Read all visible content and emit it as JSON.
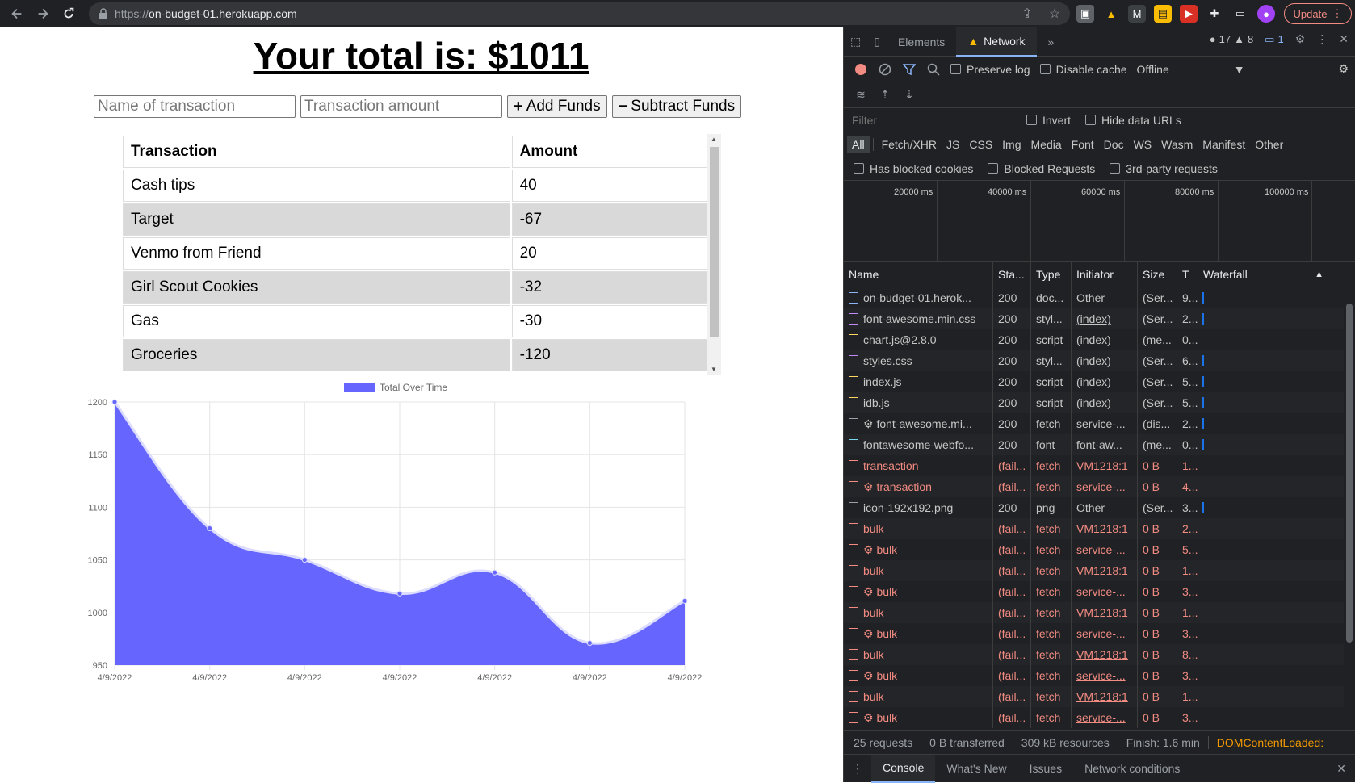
{
  "browser": {
    "url_scheme": "https://",
    "url_host": "on-budget-01.herokuapp.com",
    "update_label": "Update"
  },
  "page": {
    "total_text": "Your total is: $1011",
    "name_placeholder": "Name of transaction",
    "amount_placeholder": "Transaction amount",
    "add_label": "Add Funds",
    "subtract_label": "Subtract Funds",
    "table": {
      "headers": [
        "Transaction",
        "Amount"
      ],
      "rows": [
        [
          "Cash tips",
          "40"
        ],
        [
          "Target",
          "-67"
        ],
        [
          "Venmo from Friend",
          "20"
        ],
        [
          "Girl Scout Cookies",
          "-32"
        ],
        [
          "Gas",
          "-30"
        ],
        [
          "Groceries",
          "-120"
        ]
      ]
    }
  },
  "chart_data": {
    "type": "area",
    "legend": "Total Over Time",
    "legend_position": "top",
    "color": "#6666ff",
    "x": [
      "4/9/2022",
      "4/9/2022",
      "4/9/2022",
      "4/9/2022",
      "4/9/2022",
      "4/9/2022",
      "4/9/2022"
    ],
    "values": [
      1200,
      1080,
      1050,
      1018,
      1038,
      971,
      1011
    ],
    "ylim": [
      950,
      1200
    ],
    "yticks": [
      950,
      1000,
      1050,
      1100,
      1150,
      1200
    ],
    "grid": true
  },
  "devtools": {
    "tabs": [
      "Elements",
      "Network"
    ],
    "active_tab": "Network",
    "badges": {
      "errors": "17",
      "warnings": "8",
      "messages": "1"
    },
    "toolbar": {
      "preserve_log": "Preserve log",
      "disable_cache": "Disable cache",
      "throttle": "Offline"
    },
    "filter_placeholder": "Filter",
    "invert": "Invert",
    "hide_data_urls": "Hide data URLs",
    "types": [
      "All",
      "Fetch/XHR",
      "JS",
      "CSS",
      "Img",
      "Media",
      "Font",
      "Doc",
      "WS",
      "Wasm",
      "Manifest",
      "Other"
    ],
    "blocked": [
      "Has blocked cookies",
      "Blocked Requests",
      "3rd-party requests"
    ],
    "overview_labels": [
      "20000 ms",
      "40000 ms",
      "60000 ms",
      "80000 ms",
      "100000 ms"
    ],
    "columns": [
      "Name",
      "Sta...",
      "Type",
      "Initiator",
      "Size",
      "T",
      "Waterfall"
    ],
    "requests": [
      {
        "name": "on-budget-01.herok...",
        "status": "200",
        "type": "doc...",
        "initiator": "Other",
        "size": "(Ser...",
        "time": "9...",
        "fail": false,
        "link": false,
        "icon": "doc",
        "bar": true
      },
      {
        "name": "font-awesome.min.css",
        "status": "200",
        "type": "styl...",
        "initiator": "(index)",
        "size": "(Ser...",
        "time": "2...",
        "fail": false,
        "link": true,
        "icon": "css",
        "bar": true
      },
      {
        "name": "chart.js@2.8.0",
        "status": "200",
        "type": "script",
        "initiator": "(index)",
        "size": "(me...",
        "time": "0...",
        "fail": false,
        "link": true,
        "icon": "js",
        "bar": false
      },
      {
        "name": "styles.css",
        "status": "200",
        "type": "styl...",
        "initiator": "(index)",
        "size": "(Ser...",
        "time": "6...",
        "fail": false,
        "link": true,
        "icon": "css",
        "bar": true
      },
      {
        "name": "index.js",
        "status": "200",
        "type": "script",
        "initiator": "(index)",
        "size": "(Ser...",
        "time": "5...",
        "fail": false,
        "link": true,
        "icon": "js",
        "bar": true
      },
      {
        "name": "idb.js",
        "status": "200",
        "type": "script",
        "initiator": "(index)",
        "size": "(Ser...",
        "time": "5...",
        "fail": false,
        "link": true,
        "icon": "js",
        "bar": true
      },
      {
        "name": "⚙ font-awesome.mi...",
        "status": "200",
        "type": "fetch",
        "initiator": "service-...",
        "size": "(dis...",
        "time": "2...",
        "fail": false,
        "link": true,
        "icon": "blank",
        "bar": true
      },
      {
        "name": "fontawesome-webfo...",
        "status": "200",
        "type": "font",
        "initiator": "font-aw...",
        "size": "(me...",
        "time": "0...",
        "fail": false,
        "link": true,
        "icon": "font",
        "bar": true
      },
      {
        "name": "transaction",
        "status": "(fail...",
        "type": "fetch",
        "initiator": "VM1218:1",
        "size": "0 B",
        "time": "1...",
        "fail": true,
        "link": true,
        "icon": "fail",
        "bar": false
      },
      {
        "name": "⚙ transaction",
        "status": "(fail...",
        "type": "fetch",
        "initiator": "service-...",
        "size": "0 B",
        "time": "4...",
        "fail": true,
        "link": true,
        "icon": "fail",
        "bar": false
      },
      {
        "name": "icon-192x192.png",
        "status": "200",
        "type": "png",
        "initiator": "Other",
        "size": "(Ser...",
        "time": "3...",
        "fail": false,
        "link": false,
        "icon": "blank",
        "bar": true
      },
      {
        "name": "bulk",
        "status": "(fail...",
        "type": "fetch",
        "initiator": "VM1218:1",
        "size": "0 B",
        "time": "2...",
        "fail": true,
        "link": true,
        "icon": "fail",
        "bar": false
      },
      {
        "name": "⚙ bulk",
        "status": "(fail...",
        "type": "fetch",
        "initiator": "service-...",
        "size": "0 B",
        "time": "5...",
        "fail": true,
        "link": true,
        "icon": "fail",
        "bar": false
      },
      {
        "name": "bulk",
        "status": "(fail...",
        "type": "fetch",
        "initiator": "VM1218:1",
        "size": "0 B",
        "time": "1...",
        "fail": true,
        "link": true,
        "icon": "fail",
        "bar": false
      },
      {
        "name": "⚙ bulk",
        "status": "(fail...",
        "type": "fetch",
        "initiator": "service-...",
        "size": "0 B",
        "time": "3...",
        "fail": true,
        "link": true,
        "icon": "fail",
        "bar": false
      },
      {
        "name": "bulk",
        "status": "(fail...",
        "type": "fetch",
        "initiator": "VM1218:1",
        "size": "0 B",
        "time": "1...",
        "fail": true,
        "link": true,
        "icon": "fail",
        "bar": false
      },
      {
        "name": "⚙ bulk",
        "status": "(fail...",
        "type": "fetch",
        "initiator": "service-...",
        "size": "0 B",
        "time": "3...",
        "fail": true,
        "link": true,
        "icon": "fail",
        "bar": false
      },
      {
        "name": "bulk",
        "status": "(fail...",
        "type": "fetch",
        "initiator": "VM1218:1",
        "size": "0 B",
        "time": "8...",
        "fail": true,
        "link": true,
        "icon": "fail",
        "bar": false
      },
      {
        "name": "⚙ bulk",
        "status": "(fail...",
        "type": "fetch",
        "initiator": "service-...",
        "size": "0 B",
        "time": "3...",
        "fail": true,
        "link": true,
        "icon": "fail",
        "bar": false
      },
      {
        "name": "bulk",
        "status": "(fail...",
        "type": "fetch",
        "initiator": "VM1218:1",
        "size": "0 B",
        "time": "1...",
        "fail": true,
        "link": true,
        "icon": "fail",
        "bar": false
      },
      {
        "name": "⚙ bulk",
        "status": "(fail...",
        "type": "fetch",
        "initiator": "service-...",
        "size": "0 B",
        "time": "3...",
        "fail": true,
        "link": true,
        "icon": "fail",
        "bar": false
      }
    ],
    "summary": {
      "requests": "25 requests",
      "transferred": "0 B transferred",
      "resources": "309 kB resources",
      "finish": "Finish: 1.6 min",
      "dom": "DOMContentLoaded:"
    },
    "drawer_tabs": [
      "Console",
      "What's New",
      "Issues",
      "Network conditions"
    ],
    "colors": {
      "fail": "#f28b82",
      "accent": "#8ab4f8",
      "bar": "#1a73e8"
    }
  }
}
